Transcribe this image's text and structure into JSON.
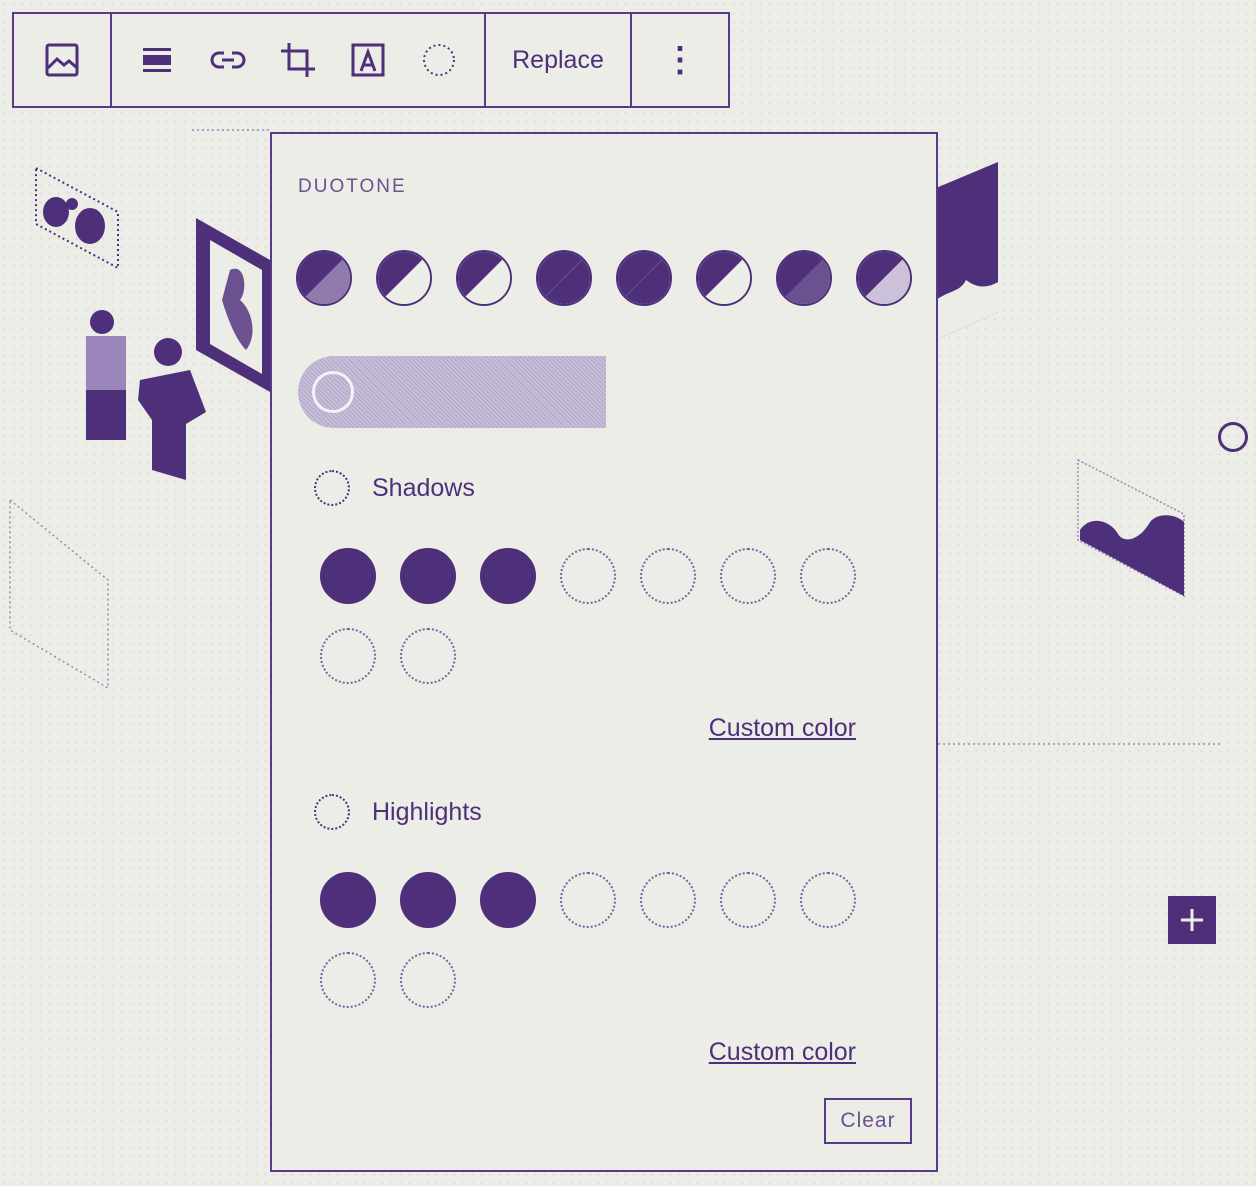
{
  "toolbar": {
    "image_icon": "image-icon",
    "tools": [
      {
        "name": "align-icon"
      },
      {
        "name": "link-icon"
      },
      {
        "name": "crop-icon"
      },
      {
        "name": "text-overlay-icon"
      },
      {
        "name": "duotone-icon"
      }
    ],
    "replace_label": "Replace",
    "more_label": "⋮"
  },
  "popover": {
    "section_label": "DUOTONE",
    "preset_count": 8,
    "shadows": {
      "label": "Shadows",
      "swatches": [
        "filled",
        "filled",
        "filled",
        "empty",
        "empty",
        "empty",
        "empty",
        "empty",
        "empty"
      ],
      "custom_color_label": "Custom color"
    },
    "highlights": {
      "label": "Highlights",
      "swatches": [
        "filled",
        "filled",
        "filled",
        "empty",
        "empty",
        "empty",
        "empty",
        "empty",
        "empty"
      ],
      "custom_color_label": "Custom color"
    },
    "clear_label": "Clear"
  },
  "colors": {
    "accent": "#4e2f7a",
    "background": "#ecede7"
  }
}
